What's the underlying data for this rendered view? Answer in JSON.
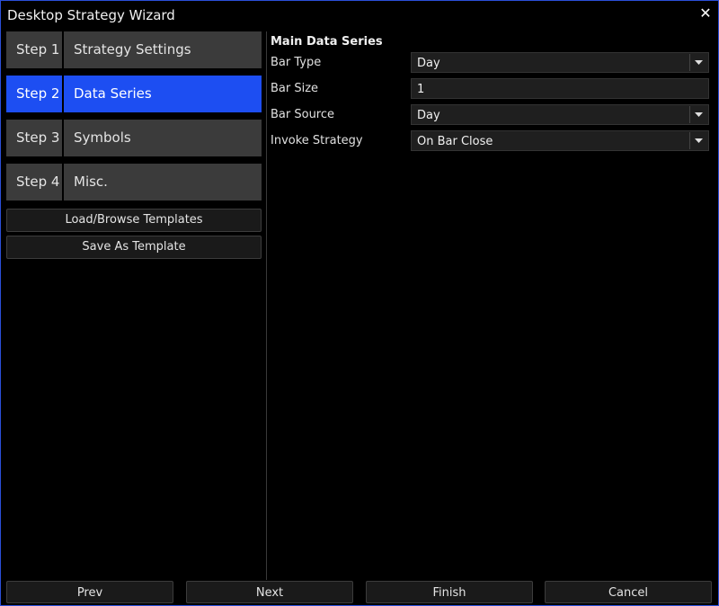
{
  "window": {
    "title": "Desktop Strategy Wizard"
  },
  "steps": [
    {
      "num": "Step 1",
      "label": "Strategy Settings",
      "active": false
    },
    {
      "num": "Step 2",
      "label": "Data Series",
      "active": true
    },
    {
      "num": "Step 3",
      "label": "Symbols",
      "active": false
    },
    {
      "num": "Step 4",
      "label": "Misc.",
      "active": false
    }
  ],
  "templates": {
    "load_label": "Load/Browse Templates",
    "save_label": "Save As Template"
  },
  "main": {
    "section_title": "Main Data Series",
    "fields": [
      {
        "label": "Bar Type",
        "value": "Day"
      },
      {
        "label": "Bar Size",
        "value": "1"
      },
      {
        "label": "Bar Source",
        "value": "Day"
      },
      {
        "label": "Invoke Strategy",
        "value": "On Bar Close"
      }
    ]
  },
  "footer": {
    "prev_label": "Prev",
    "next_label": "Next",
    "finish_label": "Finish",
    "cancel_label": "Cancel"
  },
  "colors": {
    "accent": "#1d4ef2",
    "window_border": "#2b4fd8",
    "background": "#000000"
  }
}
